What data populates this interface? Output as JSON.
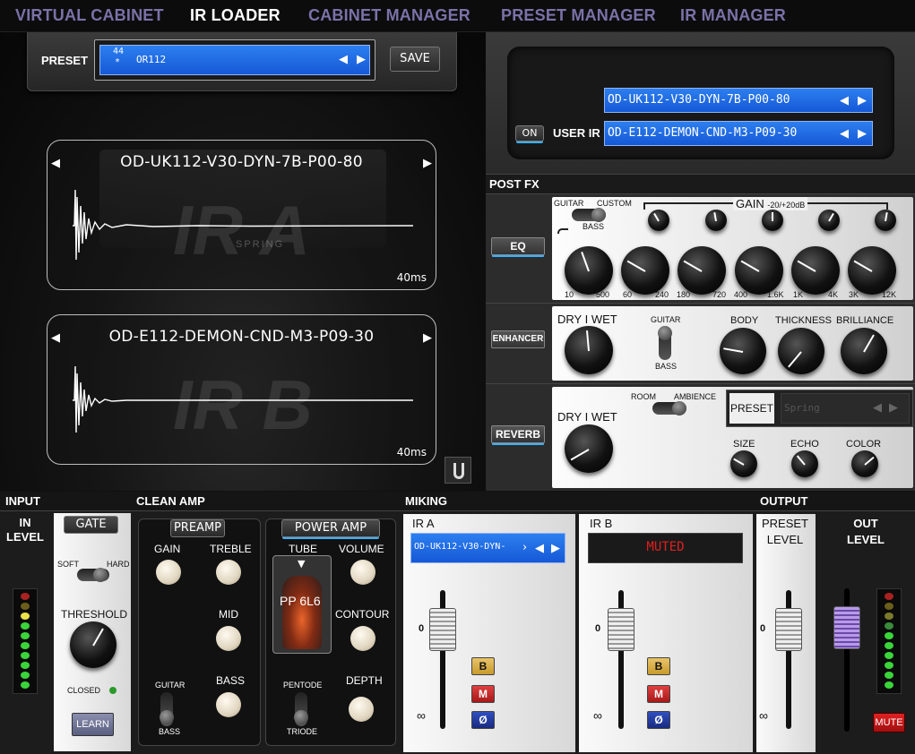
{
  "nav": {
    "tabs": [
      {
        "label": "VIRTUAL CABINET"
      },
      {
        "label": "IR LOADER"
      },
      {
        "label": "CABINET MANAGER"
      },
      {
        "label": "PRESET MANAGER"
      },
      {
        "label": "IR MANAGER"
      }
    ],
    "active": "IR LOADER"
  },
  "preset": {
    "label": "PRESET",
    "number": "44",
    "marker": "*",
    "name": "OR112",
    "save_label": "SAVE"
  },
  "ir_a": {
    "name": "OD-UK112-V30-DYN-7B-P00-80",
    "big_label": "IR A",
    "time": "40ms",
    "watermark": "SPRING"
  },
  "ir_b": {
    "name": "OD-E112-DEMON-CND-M3-P09-30",
    "big_label": "IR B",
    "time": "40ms"
  },
  "user_ir": {
    "on_label": "ON",
    "label": "USER IR",
    "slot1": "OD-UK112-V30-DYN-7B-P00-80",
    "slot2": "OD-E112-DEMON-CND-M3-P09-30"
  },
  "post_fx": {
    "title": "POST FX",
    "eq": {
      "button": "EQ",
      "guitar": "GUITAR",
      "custom": "CUSTOM",
      "bass": "BASS",
      "gain": "GAIN",
      "gain_range": "-20/+20dB",
      "freqs": [
        [
          "10",
          "500"
        ],
        [
          "60",
          "240"
        ],
        [
          "180",
          "720"
        ],
        [
          "400",
          "1.6K"
        ],
        [
          "1K",
          "4K"
        ],
        [
          "3K",
          "12K"
        ]
      ]
    },
    "enhancer": {
      "button": "ENHANCER",
      "drywet": "DRY I WET",
      "guitar": "GUITAR",
      "bass": "BASS",
      "body": "BODY",
      "thickness": "THICKNESS",
      "brilliance": "BRILLIANCE"
    },
    "reverb": {
      "button": "REVERB",
      "drywet": "DRY I WET",
      "room": "ROOM",
      "ambience": "AMBIENCE",
      "preset_label": "PRESET",
      "preset_value": "Spring",
      "size": "SIZE",
      "echo": "ECHO",
      "color": "COLOR"
    }
  },
  "input": {
    "title": "INPUT",
    "in_level": "IN LEVEL",
    "gate": "GATE",
    "soft": "SOFT",
    "hard": "HARD",
    "threshold": "THRESHOLD",
    "closed": "CLOSED",
    "learn": "LEARN"
  },
  "clean_amp": {
    "title": "CLEAN AMP",
    "preamp": "PREAMP",
    "power_amp": "POWER AMP",
    "gain": "GAIN",
    "treble": "TREBLE",
    "mid": "MID",
    "bass": "BASS",
    "guitar": "GUITAR",
    "bass_sw": "BASS",
    "tube": "TUBE",
    "tube_value": "PP 6L6",
    "volume": "VOLUME",
    "contour": "CONTOUR",
    "depth": "DEPTH",
    "pentode": "PENTODE",
    "triode": "TRIODE"
  },
  "miking": {
    "title": "MIKING",
    "ir_a_label": "IR A",
    "ir_a_value": "OD-UK112-V30-DYN-",
    "ir_b_label": "IR B",
    "ir_b_value": "MUTED",
    "b": "B",
    "m": "M",
    "phase": "Ø",
    "zero": "0",
    "inf": "∞"
  },
  "output": {
    "title": "OUTPUT",
    "preset_level": "PRESET LEVEL",
    "out_level": "OUT LEVEL",
    "mute": "MUTE"
  },
  "colors": {
    "lcd_blue": "#1e6cf0",
    "accent_cyan": "#3ab0ff",
    "nav_purple": "#7a72a8",
    "mute_red": "#c01818"
  }
}
